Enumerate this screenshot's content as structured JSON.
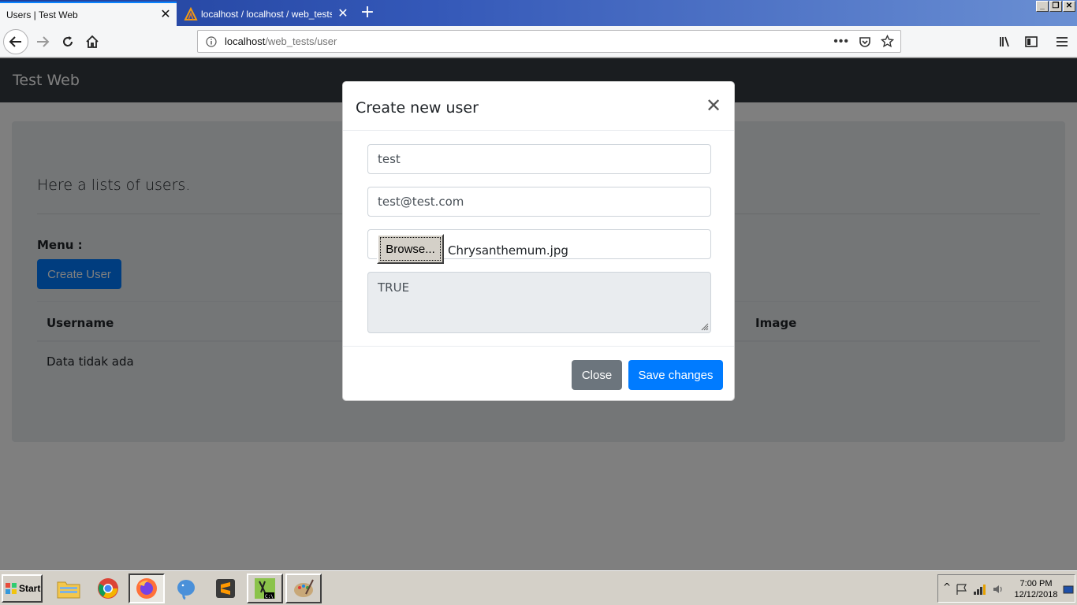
{
  "browser": {
    "tabs": [
      {
        "title": "Users | Test Web",
        "active": true
      },
      {
        "title": "localhost / localhost / web_tests |",
        "active": false
      }
    ],
    "url_host": "localhost",
    "url_path": "/web_tests/user"
  },
  "page": {
    "brand": "Test Web",
    "lead": "Here a lists of users.",
    "menu_label": "Menu :",
    "create_user_label": "Create User",
    "table": {
      "headers": [
        "Username",
        "Image"
      ],
      "empty_text": "Data tidak ada"
    }
  },
  "modal": {
    "title": "Create new user",
    "username_value": "test",
    "email_value": "test@test.com",
    "browse_label": "Browse...",
    "file_name": "Chrysanthemum.jpg",
    "textarea_value": "TRUE",
    "close_label": "Close",
    "save_label": "Save changes"
  },
  "taskbar": {
    "start_label": "Start",
    "time": "7:00 PM",
    "date": "12/12/2018"
  },
  "colors": {
    "primary": "#007bff",
    "secondary": "#6c757d",
    "navbar_dark": "#343a40"
  }
}
